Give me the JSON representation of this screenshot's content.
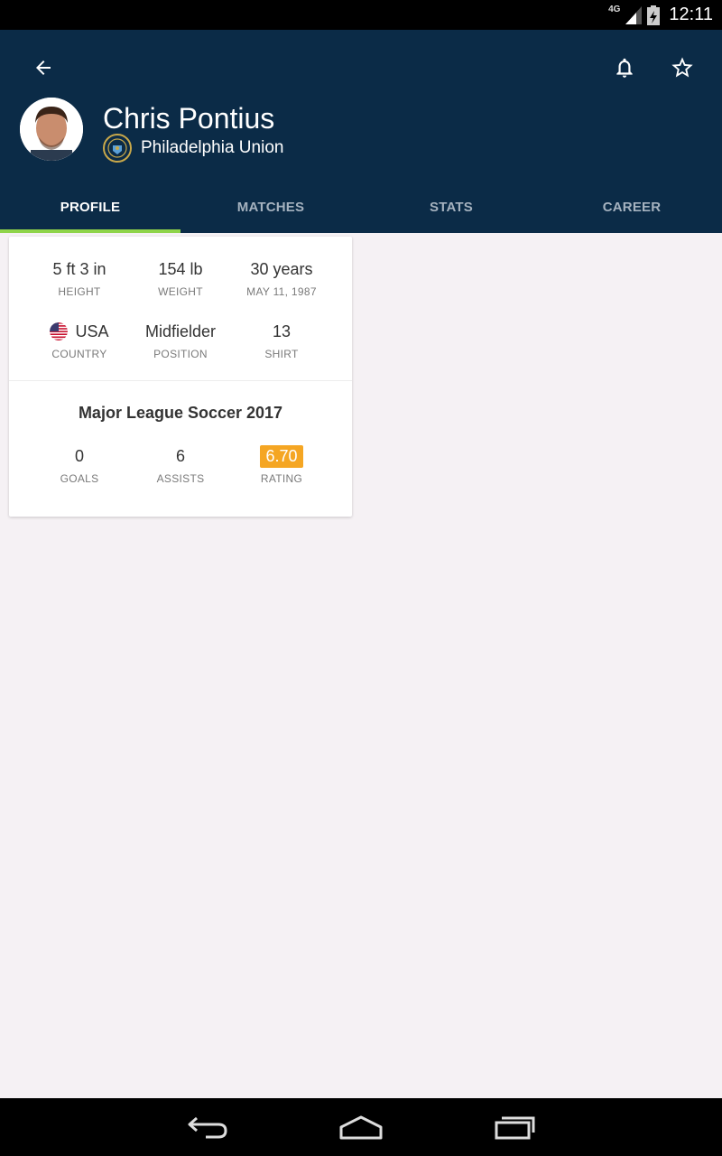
{
  "status_bar": {
    "network": "4G",
    "time": "12:11"
  },
  "player": {
    "name": "Chris Pontius",
    "club": "Philadelphia Union"
  },
  "tabs": [
    {
      "label": "PROFILE",
      "active": true
    },
    {
      "label": "MATCHES",
      "active": false
    },
    {
      "label": "STATS",
      "active": false
    },
    {
      "label": "CAREER",
      "active": false
    }
  ],
  "profile": {
    "height": {
      "value": "5 ft 3 in",
      "label": "HEIGHT"
    },
    "weight": {
      "value": "154 lb",
      "label": "WEIGHT"
    },
    "age": {
      "value": "30 years",
      "label": "MAY 11, 1987"
    },
    "country": {
      "value": "USA",
      "label": "COUNTRY"
    },
    "position": {
      "value": "Midfielder",
      "label": "POSITION"
    },
    "shirt": {
      "value": "13",
      "label": "SHIRT"
    }
  },
  "season": {
    "title": "Major League Soccer 2017",
    "goals": {
      "value": "0",
      "label": "GOALS"
    },
    "assists": {
      "value": "6",
      "label": "ASSISTS"
    },
    "rating": {
      "value": "6.70",
      "label": "RATING"
    }
  },
  "colors": {
    "header_bg": "#0b2b47",
    "tab_indicator": "#8fd44a",
    "rating_badge": "#f5a623",
    "page_bg": "#f5f1f4"
  },
  "icons": {
    "back": "arrow-left-icon",
    "bell": "bell-icon",
    "star": "star-outline-icon",
    "nav_back": "back-icon",
    "nav_home": "home-icon",
    "nav_recents": "recents-icon"
  }
}
